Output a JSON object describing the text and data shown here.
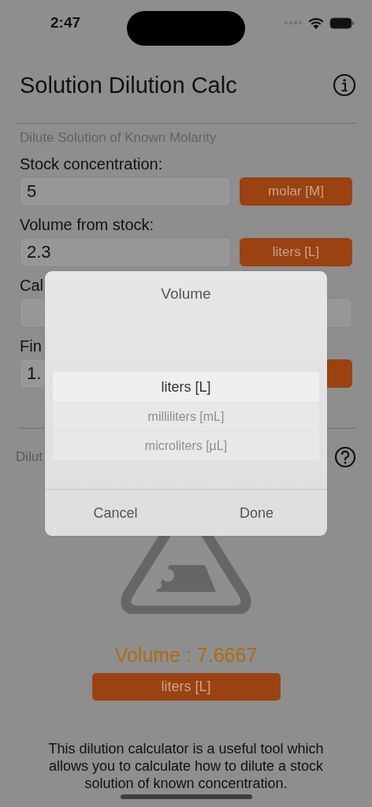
{
  "status_bar": {
    "time": "2:47"
  },
  "header": {
    "title": "Solution Dilution Calc"
  },
  "section": {
    "title": "Dilute Solution of Known Molarity"
  },
  "inputs": [
    {
      "kind": "with_unit",
      "label": "Stock concentration:",
      "value": "5",
      "unit": "molar [M]"
    },
    {
      "kind": "with_unit",
      "label": "Volume from stock:",
      "value": "2.3",
      "unit": "liters [L]"
    },
    {
      "kind": "wide",
      "label": "Cal"
    },
    {
      "kind": "with_unit",
      "label": "Fin",
      "value": "1."
    }
  ],
  "result": {
    "title": "Dilut",
    "value": "Volume : 7.6667",
    "unit": "liters [L]",
    "description": "This dilution calculator is a useful tool which allows you to calculate how to dilute a stock solution of known concentration."
  },
  "picker": {
    "title": "Volume",
    "options": [
      {
        "label": "liters [L]",
        "selected": true
      },
      {
        "label": "milliliters [mL]",
        "selected": false
      },
      {
        "label": "microliters [µL]",
        "selected": false
      }
    ],
    "buttons": [
      "Cancel",
      "Done"
    ]
  }
}
